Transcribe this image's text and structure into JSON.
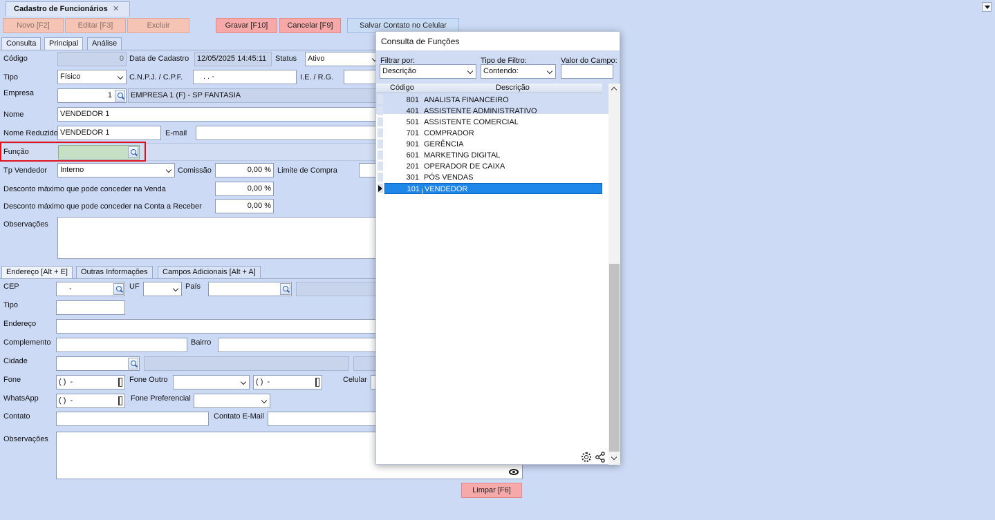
{
  "window": {
    "tab_title": "Cadastro de Funcionários",
    "close_glyph": "✕"
  },
  "toolbar": {
    "novo": "Novo [F2]",
    "editar": "Editar [F3]",
    "excluir": "Excluir",
    "gravar": "Gravar [F10]",
    "cancelar": "Cancelar [F9]",
    "salvar_contato": "Salvar Contato no Celular"
  },
  "tabs": [
    "Consulta",
    "Principal",
    "Análise"
  ],
  "form": {
    "codigo_label": "Código",
    "codigo_value": "0",
    "data_cadastro_label": "Data de Cadastro",
    "data_cadastro_value": "12/05/2025 14:45:11",
    "status_label": "Status",
    "status_value": "Ativo",
    "tipo_label": "Tipo",
    "tipo_value": "Físico",
    "cnpj_label": "C.N.P.J. / C.P.F.",
    "cnpj_value": ". . -",
    "ie_label": "I.E. / R.G.",
    "empresa_label": "Empresa",
    "empresa_code": "1",
    "empresa_name": "EMPRESA 1 (F) - SP FANTASIA",
    "nome_label": "Nome",
    "nome_value": "VENDEDOR 1",
    "nome_reduzido_label": "Nome Reduzido",
    "nome_reduzido_value": "VENDEDOR 1",
    "email_label": "E-mail",
    "funcao_label": "Função",
    "tp_vendedor_label": "Tp Vendedor",
    "tp_vendedor_value": "Interno",
    "comissao_label": "Comissão",
    "comissao_value": "0,00 %",
    "limite_compra_label": "Limite de Compra",
    "desc_venda_label": "Desconto máximo que pode conceder na Venda",
    "desc_venda_value": "0,00 %",
    "desc_conta_label": "Desconto máximo que pode conceder na Conta a Receber",
    "desc_conta_value": "0,00 %",
    "observacoes_label": "Observações"
  },
  "address_tabs": [
    "Endereço [Alt + E]",
    "Outras Informações",
    "Campos Adicionais [Alt + A]"
  ],
  "address": {
    "cep_label": "CEP",
    "cep_value": "-",
    "uf_label": "UF",
    "pais_label": "País",
    "tipo_label": "Tipo",
    "endereco_label": "Endereço",
    "complemento_label": "Complemento",
    "bairro_label": "Bairro",
    "cidade_label": "Cidade",
    "fone_label": "Fone",
    "fone_value": "( )  -",
    "fone_outro_label": "Fone Outro",
    "fone_outro_value": "( )  -",
    "celular_label": "Celular",
    "whatsapp_label": "WhatsApp",
    "whatsapp_value": "( )  -",
    "fone_pref_label": "Fone Preferencial",
    "contato_label": "Contato",
    "contato_email_label": "Contato E-Mail",
    "observacoes_label": "Observações",
    "limpar": "Limpar [F6]"
  },
  "popup": {
    "title": "Consulta de Funções",
    "filtrar_por_label": "Filtrar por:",
    "filtrar_por_value": "Descrição",
    "tipo_filtro_label": "Tipo de Filtro:",
    "tipo_filtro_value": "Contendo:",
    "valor_campo_label": "Valor do Campo:",
    "col_codigo": "Código",
    "col_descricao": "Descrição",
    "rows": [
      {
        "code": "801",
        "desc": "ANALISTA FINANCEIRO"
      },
      {
        "code": "401",
        "desc": "ASSISTENTE ADMINISTRATIVO"
      },
      {
        "code": "501",
        "desc": "ASSISTENTE COMERCIAL"
      },
      {
        "code": "701",
        "desc": "COMPRADOR"
      },
      {
        "code": "901",
        "desc": "GERÊNCIA"
      },
      {
        "code": "601",
        "desc": "MARKETING DIGITAL"
      },
      {
        "code": "201",
        "desc": "OPERADOR DE CAIXA"
      },
      {
        "code": "301",
        "desc": "PÓS VENDAS"
      },
      {
        "code": "101",
        "desc": "VENDEDOR"
      }
    ],
    "selected_index": 8
  },
  "colors": {
    "background": "#ccdaf5",
    "highlight_border": "#e0141e",
    "selected_row": "#1e86e8",
    "funcao_field": "#c6e0c6"
  }
}
